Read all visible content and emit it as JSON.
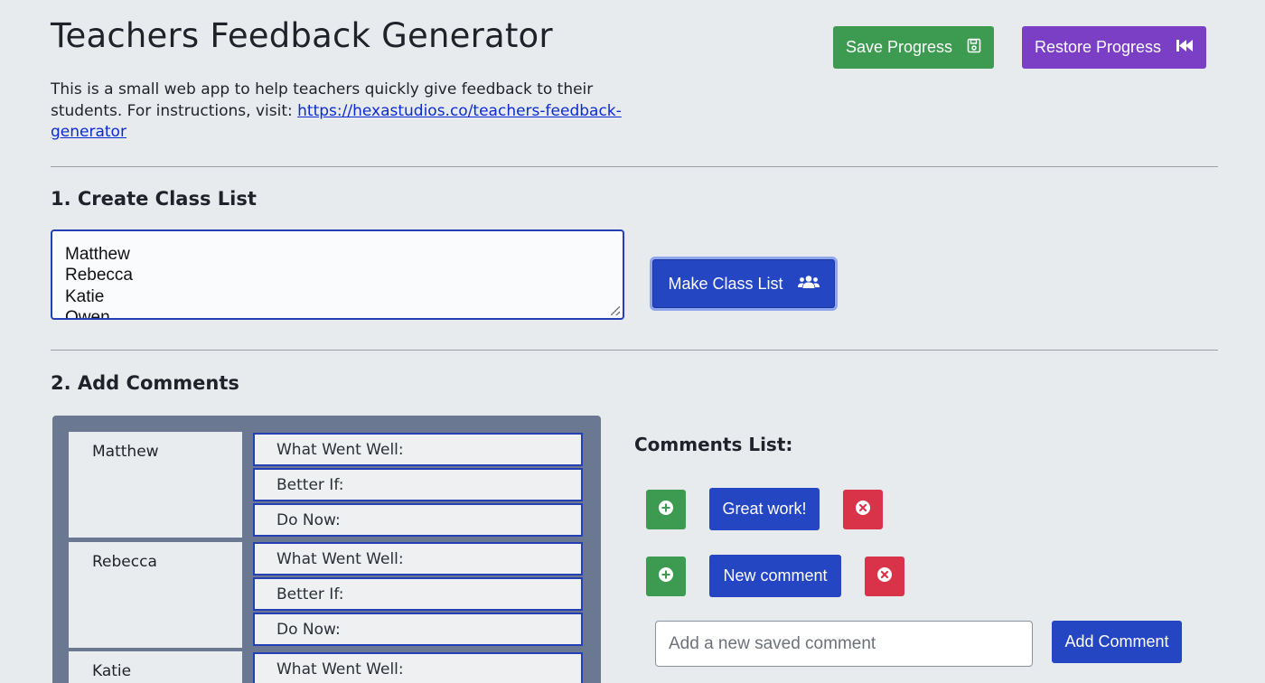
{
  "header": {
    "title": "Teachers Feedback Generator",
    "save_label": "Save Progress",
    "restore_label": "Restore Progress"
  },
  "intro": {
    "text": "This is a small web app to help teachers quickly give feedback to their students. For instructions, visit: ",
    "link_text": "https://hexastudios.co/teachers-feedback-generator"
  },
  "section1": {
    "title": "1. Create Class List",
    "class_list_lines": [
      "Matthew",
      "Rebecca",
      "Katie",
      "Owen"
    ],
    "make_button_label": "Make Class List"
  },
  "section2": {
    "title": "2. Add Comments",
    "students": [
      {
        "name": "Matthew",
        "fields": [
          "What Went Well:",
          "Better If:",
          "Do Now:"
        ]
      },
      {
        "name": "Rebecca",
        "fields": [
          "What Went Well:",
          "Better If:",
          "Do Now:"
        ]
      },
      {
        "name": "Katie",
        "fields": [
          "What Went Well:"
        ]
      }
    ]
  },
  "comments": {
    "title": "Comments List:",
    "items": [
      "Great work!",
      "New comment"
    ],
    "new_placeholder": "Add a new saved comment",
    "add_button_label": "Add Comment"
  },
  "icons": {
    "save": "floppy-disk-icon",
    "restore": "fast-backward-icon",
    "make": "users-icon",
    "add_to_feedback": "plus-circle-icon",
    "delete": "x-circle-icon"
  },
  "colors": {
    "background": "#e8ebee",
    "success": "#3c9b51",
    "purple": "#7a3fc4",
    "primary": "#2446c3",
    "danger": "#d9334a",
    "panel": "#6a7892",
    "link": "#0b2bd0"
  }
}
